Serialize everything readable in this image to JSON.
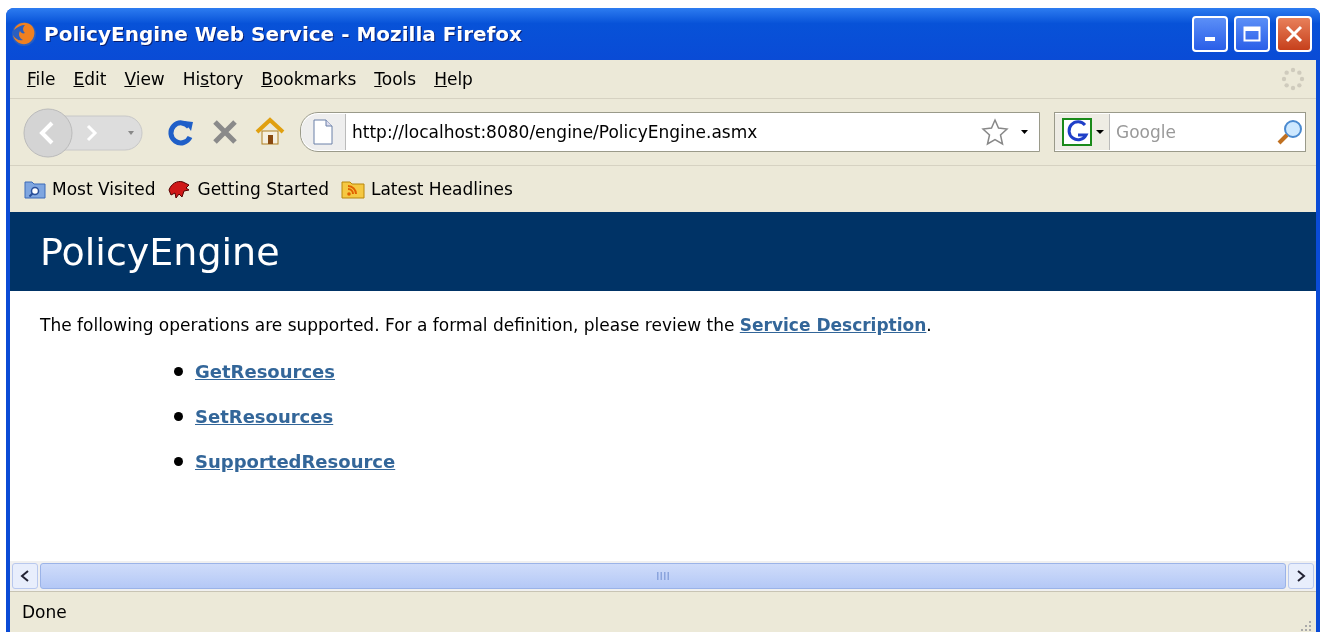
{
  "window": {
    "title": "PolicyEngine Web Service - Mozilla Firefox"
  },
  "menu": [
    {
      "label": "File"
    },
    {
      "label": "Edit"
    },
    {
      "label": "View"
    },
    {
      "label": "History"
    },
    {
      "label": "Bookmarks"
    },
    {
      "label": "Tools"
    },
    {
      "label": "Help"
    }
  ],
  "address": {
    "value": "http://localhost:8080/engine/PolicyEngine.asmx"
  },
  "search": {
    "placeholder": "Google"
  },
  "bookmarks": [
    {
      "label": "Most Visited",
      "kind": "folder"
    },
    {
      "label": "Getting Started",
      "kind": "dino"
    },
    {
      "label": "Latest Headlines",
      "kind": "feed"
    }
  ],
  "page": {
    "heading": "PolicyEngine",
    "intro_before": "The following operations are supported. For a formal definition, please review the ",
    "intro_link": "Service Description",
    "intro_after": ".",
    "operations": [
      "GetResources",
      "SetResources",
      "SupportedResource"
    ]
  },
  "status_bar": {
    "text": "Done"
  }
}
